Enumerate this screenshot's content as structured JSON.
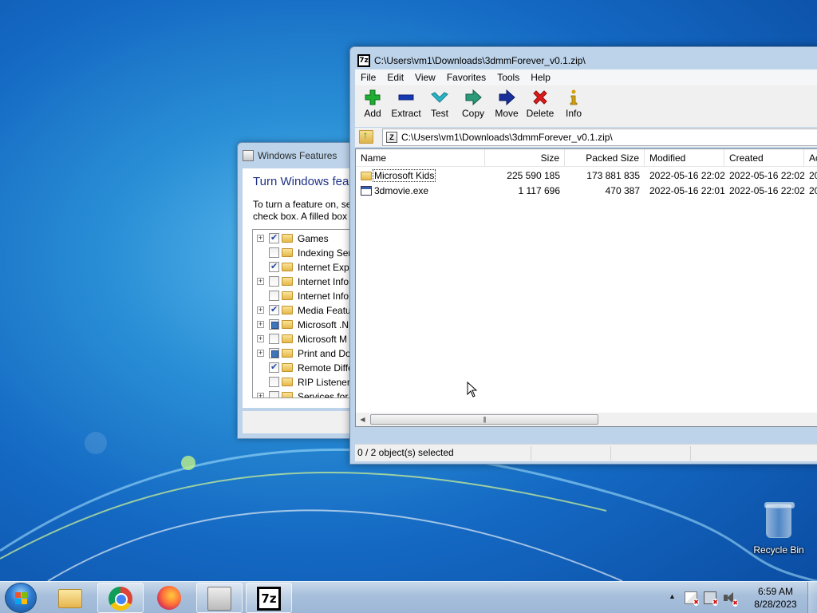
{
  "colors": {
    "desktop_blue": "#1a72c8",
    "window_frame": "#bcd3ea",
    "heading_blue": "#1e3287",
    "taskbar": "#b4c8e0",
    "delete_red": "#e01b1b",
    "add_green": "#1fae32",
    "extract_blue": "#1538b5",
    "test_teal": "#2ab6c8",
    "move_navy": "#1a2f9c"
  },
  "windows_features": {
    "title": "Windows Features",
    "heading": "Turn Windows fea",
    "description_line1": "To turn a feature on, se",
    "description_line2": "check box. A filled box",
    "items": [
      {
        "label": "Games",
        "state": "checked",
        "expandable": true
      },
      {
        "label": "Indexing Serv",
        "state": "unchecked",
        "expandable": false
      },
      {
        "label": "Internet Expl",
        "state": "checked",
        "expandable": false
      },
      {
        "label": "Internet Info",
        "state": "unchecked",
        "expandable": true
      },
      {
        "label": "Internet Info",
        "state": "unchecked",
        "expandable": false
      },
      {
        "label": "Media Featu",
        "state": "checked",
        "expandable": true
      },
      {
        "label": "Microsoft .N",
        "state": "partial",
        "expandable": true
      },
      {
        "label": "Microsoft M",
        "state": "unchecked",
        "expandable": true
      },
      {
        "label": "Print and Do",
        "state": "partial",
        "expandable": true
      },
      {
        "label": "Remote Diffe",
        "state": "checked",
        "expandable": false
      },
      {
        "label": "RIP Listener",
        "state": "unchecked",
        "expandable": false
      },
      {
        "label": "Services for N",
        "state": "unchecked",
        "expandable": true
      }
    ]
  },
  "zip": {
    "title": "C:\\Users\\vm1\\Downloads\\3dmmForever_v0.1.zip\\",
    "app_icon_text": "7z",
    "menu": [
      "File",
      "Edit",
      "View",
      "Favorites",
      "Tools",
      "Help"
    ],
    "toolbar": {
      "add": "Add",
      "extract": "Extract",
      "test": "Test",
      "copy": "Copy",
      "move": "Move",
      "delete": "Delete",
      "info": "Info"
    },
    "address": "C:\\Users\\vm1\\Downloads\\3dmmForever_v0.1.zip\\",
    "columns": {
      "name": "Name",
      "size": "Size",
      "packed_size": "Packed Size",
      "modified": "Modified",
      "created": "Created",
      "accessed": "Ac"
    },
    "rows": [
      {
        "name": "Microsoft Kids",
        "type": "folder",
        "size": "225 590 185",
        "packed": "173 881 835",
        "modified": "2022-05-16 22:02",
        "created": "2022-05-16 22:02",
        "accessed": "20"
      },
      {
        "name": "3dmovie.exe",
        "type": "exe",
        "size": "1 117 696",
        "packed": "470 387",
        "modified": "2022-05-16 22:01",
        "created": "2022-05-16 22:02",
        "accessed": "20"
      }
    ],
    "status": "0 / 2 object(s) selected"
  },
  "desktop": {
    "recycle_bin_label": "Recycle Bin"
  },
  "taskbar": {
    "clock_time": "6:59 AM",
    "clock_date": "8/28/2023",
    "task_7z_label": "7z"
  }
}
